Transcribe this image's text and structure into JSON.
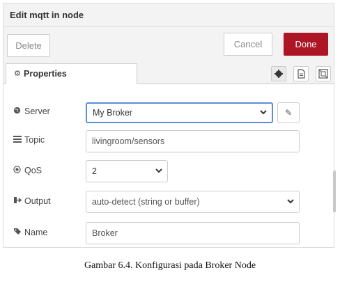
{
  "dialog": {
    "title": "Edit mqtt in node",
    "delete_label": "Delete",
    "cancel_label": "Cancel",
    "done_label": "Done",
    "accent_color": "#ad1625"
  },
  "tabs": {
    "properties_label": "Properties",
    "properties_icon": "gear-icon",
    "side_buttons": [
      "settings-icon",
      "description-icon",
      "appearance-icon"
    ]
  },
  "form": {
    "server": {
      "label": "Server",
      "icon": "globe-icon",
      "value": "My Broker"
    },
    "topic": {
      "label": "Topic",
      "icon": "tasks-icon",
      "value": "livingroom/sensors"
    },
    "qos": {
      "label": "QoS",
      "icon": "dot-circle-icon",
      "value": "2"
    },
    "output": {
      "label": "Output",
      "icon": "sign-out-icon",
      "value": "auto-detect (string or buffer)"
    },
    "name": {
      "label": "Name",
      "icon": "tag-icon",
      "value": "Broker"
    }
  },
  "caption": "Gambar 6.4. Konfigurasi pada Broker Node"
}
